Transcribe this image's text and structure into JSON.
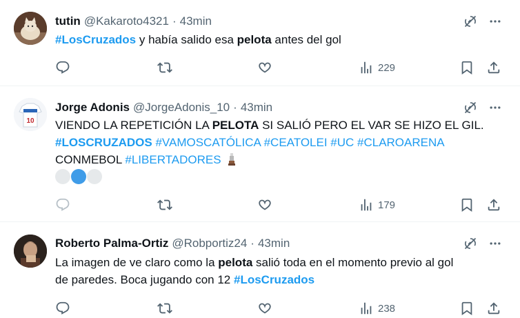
{
  "tweets": [
    {
      "name": "tutin",
      "handle": "@Kakaroto4321",
      "sep": "·",
      "time": "43min",
      "text": {
        "l1a": "#LosCruzados",
        "l1b": " y había salido esa ",
        "l1c": "pelota",
        "l1d": " antes del gol"
      },
      "views": "229"
    },
    {
      "name": "Jorge Adonis",
      "handle": "@JorgeAdonis_10",
      "sep": "·",
      "time": "43min",
      "text": {
        "l1a": "VIENDO LA REPETICIÓN LA ",
        "l1b": "PELOTA",
        "l1c": " SI SALIÓ PERO EL VAR SE HIZO EL GIL.",
        "l2": "#LOSCRUZADOS",
        "l2b": " #VAMOSCATÓLICA #CEATOLEI #UC #CLAROARENA",
        "l3a": "CONMEBOL ",
        "l3b": "#LIBERTADORES"
      },
      "views": "179"
    },
    {
      "name": "Roberto Palma-Ortiz",
      "handle": "@Robportiz24",
      "sep": "·",
      "time": "43min",
      "text": {
        "l1a": "La imagen de ve claro como la ",
        "l1b": "pelota",
        "l1c": " salió toda en el momento previo al gol",
        "l2a": "de paredes. Boca jugando con 12 ",
        "l2b": "#LosCruzados"
      },
      "views": "238"
    }
  ],
  "icons": [
    "reply-icon",
    "retweet-icon",
    "like-icon",
    "views-icon",
    "bookmark-icon",
    "share-icon",
    "grok-icon",
    "more-icon"
  ],
  "colors": {
    "link": "#1d9bf0",
    "muted": "#536471",
    "text": "#0f1419"
  }
}
